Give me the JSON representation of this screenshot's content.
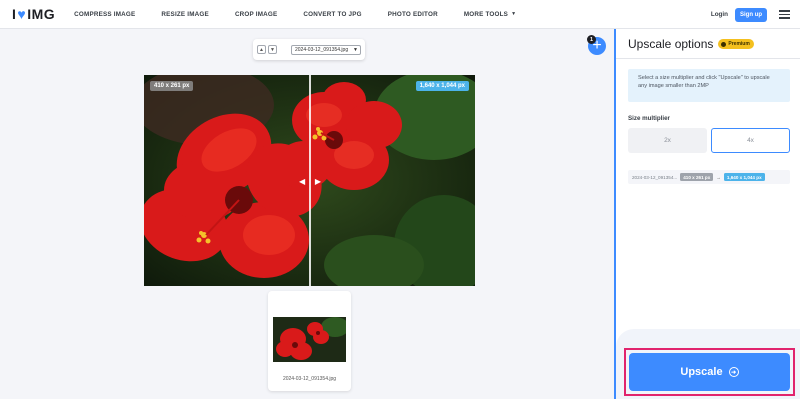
{
  "header": {
    "logo_left": "I",
    "logo_right": "IMG",
    "nav": [
      "COMPRESS IMAGE",
      "RESIZE IMAGE",
      "CROP IMAGE",
      "CONVERT TO JPG",
      "PHOTO EDITOR",
      "MORE TOOLS"
    ],
    "login": "Login",
    "signup": "Sign up"
  },
  "workspace": {
    "file_name": "2024-03-12_091354.jpg",
    "badge_count": "1",
    "original_size": "410 x 261 px",
    "upscaled_size": "1,640 x 1,044 px"
  },
  "panel": {
    "title": "Upscale options",
    "premium": "Premium",
    "info": "Select a size multiplier and click \"Upscale\" to upscale any image smaller than 2MP",
    "size_multiplier_label": "Size multiplier",
    "options": [
      "2x",
      "4x"
    ],
    "selected_option": "4x",
    "file_row_name": "2024-03-12_091354...",
    "upscale_button": "Upscale"
  },
  "colors": {
    "accent": "#3d8bff",
    "highlight": "#e1246d",
    "premium": "#f4c01f"
  }
}
